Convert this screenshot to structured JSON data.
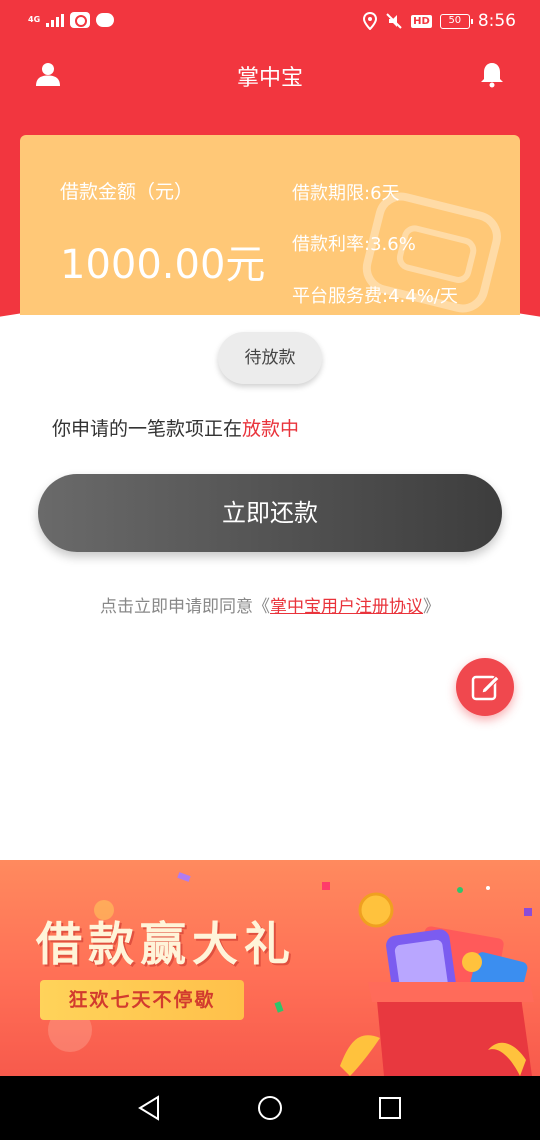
{
  "status_bar": {
    "network_tag": "4G",
    "hd_label": "HD",
    "battery": "50",
    "time": "8:56"
  },
  "nav": {
    "title": "掌中宝",
    "left_icon": "user-icon",
    "right_icon": "bell-icon"
  },
  "loan_card": {
    "amount_label": "借款金额（元）",
    "amount_value": "1000.00元",
    "term": "借款期限:6天",
    "rate": "借款利率:3.6%",
    "fee": "平台服务费:4.4%/天"
  },
  "pending_label": "待放款",
  "status_message": {
    "prefix": "你申请的一笔款项正在",
    "highlight": "放款中"
  },
  "repay_button": "立即还款",
  "agreement": {
    "prefix": "点击立即申请即同意《",
    "link": "掌中宝用户注册协议",
    "suffix": "》"
  },
  "promo": {
    "title": "借款赢大礼",
    "subtitle": "狂欢七天不停歇"
  },
  "colors": {
    "brand_red": "#f2363f",
    "card_orange": "#ffc877",
    "highlight_red": "#e9333b"
  }
}
